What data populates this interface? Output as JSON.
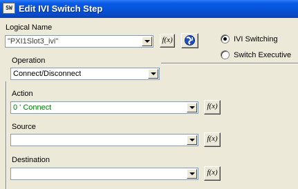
{
  "window": {
    "title": "Edit IVI Switch Step",
    "icon_text": "SW"
  },
  "logical_name": {
    "label": "Logical Name",
    "value": "\"PXI1Slot3_ivi\"",
    "fx_label": "f(x)"
  },
  "mode": {
    "options": [
      {
        "label": "IVI Switching",
        "selected": true
      },
      {
        "label": "Switch Executive",
        "selected": false
      }
    ]
  },
  "operation": {
    "label": "Operation",
    "value": "Connect/Disconnect"
  },
  "action": {
    "label": "Action",
    "value": "0 ' Connect",
    "value_color": "#008000",
    "fx_label": "f(x)"
  },
  "source": {
    "label": "Source",
    "value": "",
    "fx_label": "f(x)"
  },
  "destination": {
    "label": "Destination",
    "value": "",
    "fx_label": "f(x)"
  }
}
